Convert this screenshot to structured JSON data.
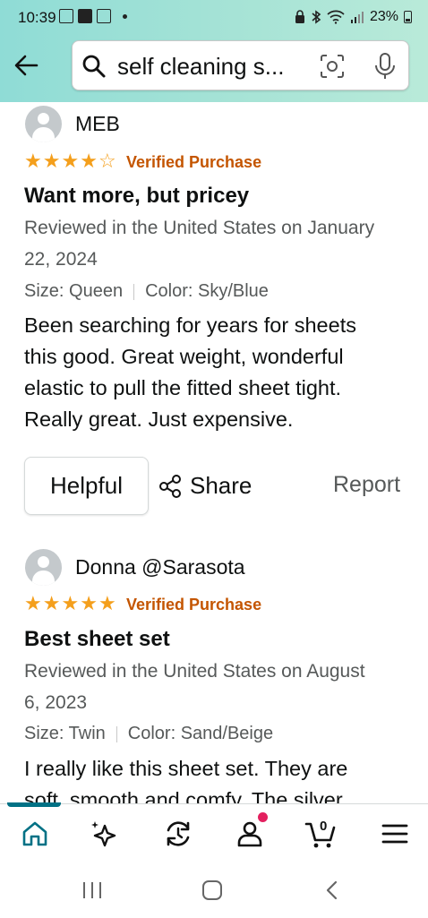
{
  "status_bar": {
    "time": "10:39",
    "battery": "23%"
  },
  "search": {
    "query": "self cleaning s..."
  },
  "reviews": [
    {
      "author": "MEB",
      "rating": 4,
      "verified": "Verified Purchase",
      "title": "Want more, but pricey",
      "date_line_1": "Reviewed in the United States on January",
      "date_line_2": "22, 2024",
      "size": "Size: Queen",
      "color": "Color: Sky/Blue",
      "body_lines": [
        "Been searching for years for sheets",
        "this good. Great weight, wonderful",
        "elastic to pull the fitted sheet tight.",
        "Really great. Just expensive."
      ],
      "helpful_label": "Helpful",
      "share_label": "Share",
      "report_label": "Report"
    },
    {
      "author": "Donna @Sarasota",
      "rating": 5,
      "verified": "Verified Purchase",
      "title": "Best sheet set",
      "date_line_1": "Reviewed in the United States on August",
      "date_line_2": "6, 2023",
      "size": "Size: Twin",
      "color": "Color: Sand/Beige",
      "body_lines": [
        "I really like this sheet set. They are",
        "soft, smooth and comfy. The silver"
      ]
    }
  ],
  "bottom_nav": {
    "items": [
      "home-icon",
      "sparkle-icon",
      "returns-icon",
      "account-icon",
      "cart-icon",
      "menu-icon"
    ],
    "cart_count": "0",
    "active": "home",
    "accent_color": "#007185"
  },
  "colors": {
    "star": "#f49f1c",
    "verified": "#c45500",
    "header_gradient_start": "#8fdcd6",
    "header_gradient_end": "#b9ead9"
  }
}
